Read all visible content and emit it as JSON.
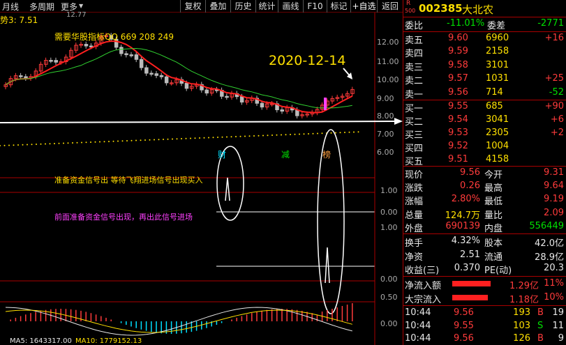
{
  "toolbar": {
    "left_items": [
      "月线",
      "多周期",
      "更多"
    ],
    "buttons": [
      "复权",
      "叠加",
      "历史",
      "统计",
      "画线",
      "F10",
      "标记",
      "+自选",
      "返回"
    ]
  },
  "chart": {
    "indicator_label": "势3: 7.51",
    "top_axis_text": "12.77",
    "watermark": "需要华股指标QQ 669 208 249",
    "date_annotation": "2020-12-14",
    "axis_main": [
      "12.00",
      "11.00",
      "10.00",
      "9.00",
      "8.00",
      "7.00",
      "6.00"
    ],
    "axis_sub1": [
      "1.00",
      "0.00"
    ],
    "axis_sub2": [
      "1.00",
      "0.00"
    ],
    "axis_sub3": [
      "0.50",
      "0.00"
    ],
    "markers": [
      {
        "text": "财",
        "color": "#00e0ff"
      },
      {
        "text": "减",
        "color": "#00e000"
      },
      {
        "text": "榜",
        "color": "#ffa040"
      }
    ],
    "signal_text_1": "准备资金信号出 等待飞翔进场信号出现买入",
    "signal_text_2": "前面准备资金信号出现，再出此信号进场",
    "ma_bottom": [
      {
        "text": "MA5: 1643317.00",
        "color": "#e8e8e8"
      },
      {
        "text": "MA10: 1779152.13",
        "color": "#ffe000"
      }
    ],
    "colors": {
      "up": "#ff3b3b",
      "down": "#00e0ff",
      "ma_red": "#ff2020",
      "ma_green": "#30d030",
      "signal_text_1": "#ffe000",
      "signal_text_2": "#ff40ff"
    }
  },
  "panel": {
    "badge": "R",
    "badge_num": "500",
    "code": "002385",
    "name": "大北农",
    "ratio": {
      "label": "委比",
      "value": "-11.01%",
      "label2": "委差",
      "value2": "-2771"
    },
    "asks": [
      {
        "label": "卖五",
        "price": "9.60",
        "vol": "6960",
        "chg": "+16"
      },
      {
        "label": "卖四",
        "price": "9.59",
        "vol": "2158",
        "chg": ""
      },
      {
        "label": "卖三",
        "price": "9.58",
        "vol": "3101",
        "chg": ""
      },
      {
        "label": "卖二",
        "price": "9.57",
        "vol": "1031",
        "chg": "+25"
      },
      {
        "label": "卖一",
        "price": "9.56",
        "vol": "714",
        "chg": "-52"
      }
    ],
    "bids": [
      {
        "label": "买一",
        "price": "9.55",
        "vol": "685",
        "chg": "+90"
      },
      {
        "label": "买二",
        "price": "9.54",
        "vol": "3041",
        "chg": "+6"
      },
      {
        "label": "买三",
        "price": "9.53",
        "vol": "2305",
        "chg": "+2"
      },
      {
        "label": "买四",
        "price": "9.52",
        "vol": "1004",
        "chg": ""
      },
      {
        "label": "买五",
        "price": "9.51",
        "vol": "4158",
        "chg": ""
      }
    ],
    "stats": [
      {
        "l1": "现价",
        "v1": "9.56",
        "c1": "red",
        "l2": "今开",
        "v2": "9.31",
        "c2": "red"
      },
      {
        "l1": "涨跌",
        "v1": "0.26",
        "c1": "red",
        "l2": "最高",
        "v2": "9.64",
        "c2": "red"
      },
      {
        "l1": "涨幅",
        "v1": "2.80%",
        "c1": "red",
        "l2": "最低",
        "v2": "9.19",
        "c2": "red"
      },
      {
        "l1": "总量",
        "v1": "124.7万",
        "c1": "yellow",
        "l2": "量比",
        "v2": "2.09",
        "c2": "red"
      },
      {
        "l1": "外盘",
        "v1": "690139",
        "c1": "red",
        "l2": "内盘",
        "v2": "556449",
        "c2": "green"
      }
    ],
    "stats2": [
      {
        "l1": "换手",
        "v1": "4.32%",
        "l2": "股本",
        "v2": "42.0亿"
      },
      {
        "l1": "净资",
        "v1": "2.51",
        "l2": "流通",
        "v2": "28.9亿"
      },
      {
        "l1": "收益(三)",
        "v1": "0.370",
        "l2": "PE(动)",
        "v2": "20.3"
      }
    ],
    "flows": [
      {
        "label": "净流入额",
        "value": "1.29亿",
        "pct": "11%",
        "bar": 0.6
      },
      {
        "label": "大宗流入",
        "value": "1.18亿",
        "pct": "10%",
        "bar": 0.55
      }
    ],
    "ticks": [
      {
        "time": "10:44",
        "price": "9.56",
        "vol": "193",
        "bs": "B",
        "n": "19"
      },
      {
        "time": "10:44",
        "price": "9.55",
        "vol": "103",
        "bs": "S",
        "n": "11"
      },
      {
        "time": "10:44",
        "price": "9.56",
        "vol": "126",
        "bs": "B",
        "n": "9"
      }
    ]
  }
}
